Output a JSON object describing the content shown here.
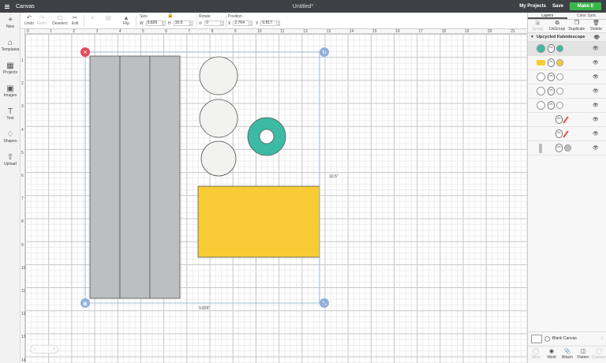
{
  "topbar": {
    "app_name": "Canvas",
    "doc_title": "Untitled*",
    "my_projects": "My Projects",
    "save": "Save",
    "make_it": "Make It"
  },
  "toolbar": {
    "undo": "Undo",
    "redo": "Redo",
    "deselect": "Deselect",
    "edit": "Edit",
    "flip": "Flip",
    "size_label": "Size",
    "w_key": "W",
    "w_value": "9.826",
    "h_key": "H",
    "h_value": "10.5",
    "rotate_label": "Rotate",
    "rotate_value": "0",
    "position_label": "Position",
    "x_key": "X",
    "x_value": "2.764",
    "y_key": "Y",
    "y_value": "0.817"
  },
  "sidebar": [
    {
      "label": "New",
      "icon": "plus-icon"
    },
    {
      "label": "Templates",
      "icon": "shirt-icon"
    },
    {
      "label": "Projects",
      "icon": "projects-icon"
    },
    {
      "label": "Images",
      "icon": "image-icon"
    },
    {
      "label": "Text",
      "icon": "text-icon"
    },
    {
      "label": "Shapes",
      "icon": "shapes-icon"
    },
    {
      "label": "Upload",
      "icon": "upload-icon"
    }
  ],
  "ruler": {
    "top": [
      "0",
      "1",
      "2",
      "3",
      "4",
      "5",
      "6",
      "7",
      "8",
      "9",
      "10",
      "11",
      "12",
      "13",
      "14",
      "15",
      "16",
      "17",
      "18",
      "19",
      "20",
      "21"
    ],
    "left": [
      "1",
      "2",
      "3",
      "4",
      "5",
      "6",
      "7",
      "8",
      "9",
      "10",
      "11",
      "12",
      "13",
      "14"
    ]
  },
  "canvas": {
    "height_dim": "10.5\"",
    "width_dim": "9.826\"",
    "colors": {
      "gray": "#bdbec0",
      "light": "#f2f2f0",
      "teal": "#3dbaa4",
      "yellow": "#f9cc35",
      "red": "#e04a5a",
      "handle": "#8fb0da"
    }
  },
  "right_panel": {
    "tabs": [
      "Layers",
      "Color Sync"
    ],
    "actions": [
      "Group",
      "UnGroup",
      "Duplicate",
      "Delete"
    ],
    "group_name": "Upcycled Kaleidescope",
    "layers": [
      {
        "swatch": "#3dbaa4"
      },
      {
        "swatch": "#f9cc35"
      },
      {
        "swatch": "#ffffff"
      },
      {
        "swatch": "#ffffff"
      },
      {
        "swatch": "#ffffff"
      },
      {
        "swatch": "#e05050"
      },
      {
        "swatch": "#e05050"
      },
      {
        "swatch": "#bdbdbd"
      }
    ],
    "blank_canvas": "Blank Canvas",
    "bottom_actions": [
      "Slice",
      "Weld",
      "Attach",
      "Flatten",
      "Contour"
    ]
  }
}
